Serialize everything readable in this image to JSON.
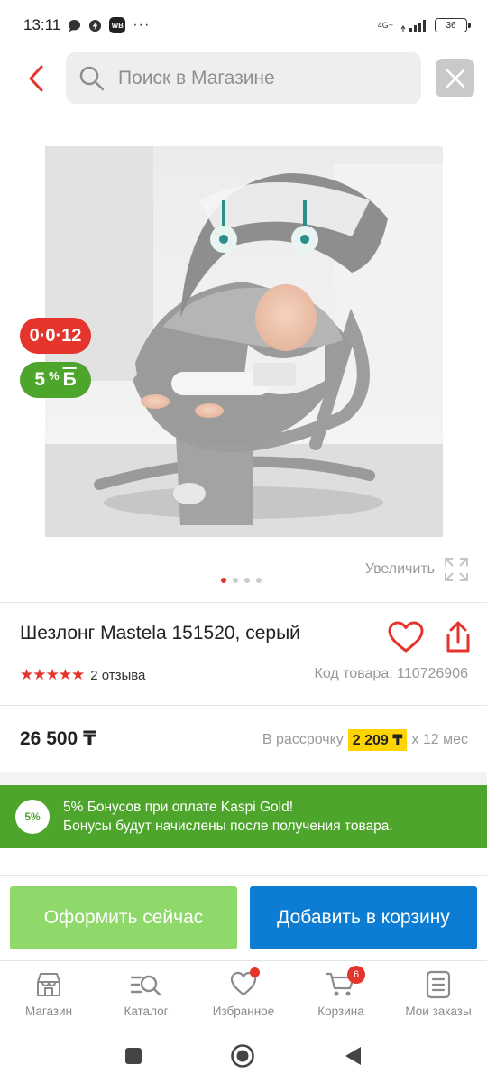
{
  "status_bar": {
    "time": "13:11",
    "network": "4G+",
    "battery": "36"
  },
  "header": {
    "search_placeholder": "Поиск в Магазине"
  },
  "product": {
    "badge_timer": "0·0·12",
    "badge_bonus_percent": "5",
    "badge_bonus_sup": "%",
    "badge_bonus_letter": "Б",
    "zoom_label": "Увеличить",
    "title": "Шезлонг Mastela 151520, серый",
    "stars": "★★★★★",
    "rating": 5,
    "reviews": "2 отзыва",
    "sku": "Код товара: 110726906",
    "price": "26 500 ₸",
    "installment_prefix": "В рассрочку",
    "installment_amount": "2 209 ₸",
    "installment_suffix": "х 12 мес",
    "gallery_total": 4,
    "gallery_active": 0
  },
  "promo": {
    "badge": "5%",
    "line1": "5% Бонусов при оплате Kaspi Gold!",
    "line2": "Бонусы будут начислены после получения товара."
  },
  "actions": {
    "checkout": "Оформить сейчас",
    "add_to_cart": "Добавить в корзину"
  },
  "tabs": [
    {
      "label": "Магазин",
      "icon": "shop-icon"
    },
    {
      "label": "Каталог",
      "icon": "catalog-search-icon"
    },
    {
      "label": "Избранное",
      "icon": "heart-icon"
    },
    {
      "label": "Корзина",
      "icon": "cart-icon",
      "badge": "6"
    },
    {
      "label": "Мои заказы",
      "icon": "orders-icon"
    }
  ],
  "colors": {
    "accent_red": "#e4342b",
    "bonus_green": "#4ea52c",
    "checkout_green": "#8fd86a",
    "cart_blue": "#0c7dd2",
    "highlight_yellow": "#ffd400"
  }
}
